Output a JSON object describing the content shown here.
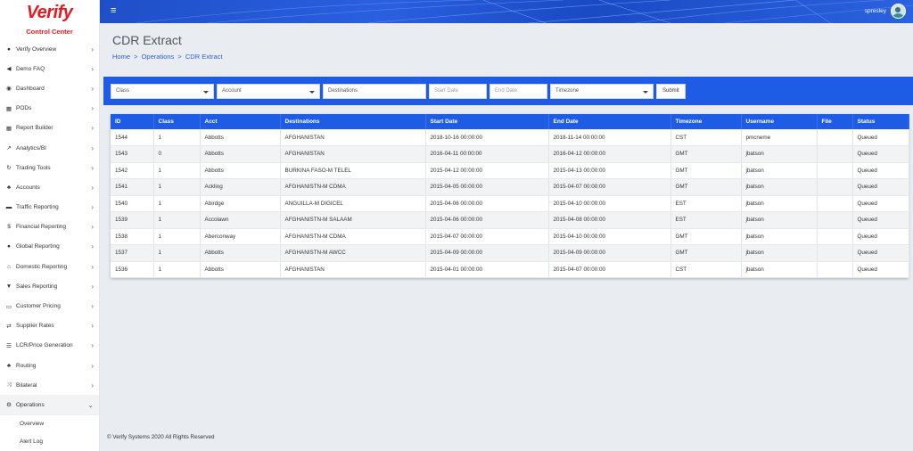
{
  "brand": {
    "logo": "Verify",
    "subtitle": "Control Center"
  },
  "colors": {
    "accent": "#1f5ce6",
    "brand_red": "#e21b23"
  },
  "sidebar": {
    "items": [
      {
        "label": "Verify Overview",
        "icon": "globe-icon",
        "glyph": "●"
      },
      {
        "label": "Demo FAQ",
        "icon": "megaphone-icon",
        "glyph": "◀"
      },
      {
        "label": "Dashboard",
        "icon": "dashboard-icon",
        "glyph": "◉"
      },
      {
        "label": "PODs",
        "icon": "table-icon",
        "glyph": "▦"
      },
      {
        "label": "Report Builder",
        "icon": "grid-icon",
        "glyph": "▦"
      },
      {
        "label": "Analytics/BI",
        "icon": "chart-icon",
        "glyph": "↗"
      },
      {
        "label": "Trading Tools",
        "icon": "refresh-icon",
        "glyph": "↻"
      },
      {
        "label": "Accounts",
        "icon": "users-icon",
        "glyph": "♣"
      },
      {
        "label": "Traffic Reporting",
        "icon": "car-icon",
        "glyph": "▬"
      },
      {
        "label": "Financial Reporting",
        "icon": "dollar-icon",
        "glyph": "$"
      },
      {
        "label": "Global Reporting",
        "icon": "globe-icon",
        "glyph": "●"
      },
      {
        "label": "Domestic Reporting",
        "icon": "home-icon",
        "glyph": "⌂"
      },
      {
        "label": "Sales Reporting",
        "icon": "cart-icon",
        "glyph": "▼"
      },
      {
        "label": "Customer Pricing",
        "icon": "money-icon",
        "glyph": "▭"
      },
      {
        "label": "Supplier Rates",
        "icon": "exchange-icon",
        "glyph": "⇄"
      },
      {
        "label": "LCR/Price Generation",
        "icon": "list-icon",
        "glyph": "☰"
      },
      {
        "label": "Routing",
        "icon": "sitemap-icon",
        "glyph": "♣"
      },
      {
        "label": "Bilateral",
        "icon": "shuffle-icon",
        "glyph": "⤨"
      },
      {
        "label": "Operations",
        "icon": "cogs-icon",
        "glyph": "⚙"
      }
    ],
    "chevron": "›",
    "open_chevron": "⌄",
    "sub_items": [
      {
        "label": "Overview"
      },
      {
        "label": "Alert Log"
      }
    ]
  },
  "topbar": {
    "menu_glyph": "≡",
    "username": "spresley"
  },
  "page": {
    "title": "CDR Extract",
    "breadcrumb": {
      "home": "Home",
      "section": "Operations",
      "current": "CDR Extract",
      "sep": ">"
    }
  },
  "filters": {
    "class_value": "Class",
    "account_value": "Account",
    "destinations_placeholder": "Destinations",
    "start_date_placeholder": "Start Date",
    "end_date_placeholder": "End Date",
    "timezone_value": "Timezone",
    "submit_label": "Submit"
  },
  "table": {
    "columns": [
      "ID",
      "Class",
      "Acct",
      "Destinations",
      "Start Date",
      "End Date",
      "Timezone",
      "Username",
      "File",
      "Status"
    ],
    "rows": [
      [
        "1544",
        "1",
        "Abbotts",
        "AFGHANISTAN",
        "2018-10-16 00:00:00",
        "2018-11-14 00:00:00",
        "CST",
        "pmcneme",
        "",
        "Queued"
      ],
      [
        "1543",
        "0",
        "Abbotts",
        "AFGHANISTAN",
        "2016-04-11 00:00:00",
        "2016-04-12 00:00:00",
        "GMT",
        "jbatson",
        "",
        "Queued"
      ],
      [
        "1542",
        "1",
        "Abbotts",
        "BURKINA FASO-M TELEL",
        "2015-04-12 00:00:00",
        "2015-04-13 00:00:00",
        "GMT",
        "jbatson",
        "",
        "Queued"
      ],
      [
        "1541",
        "1",
        "Ackling",
        "AFGHANISTN-M CDMA",
        "2015-04-05 00:00:00",
        "2015-04-07 00:00:00",
        "GMT",
        "jbatson",
        "",
        "Queued"
      ],
      [
        "1540",
        "1",
        "Abirdge",
        "ANGUILLA-M DIGICEL",
        "2015-04-06 00:00:00",
        "2015-04-10 00:00:00",
        "EST",
        "jbatson",
        "",
        "Queued"
      ],
      [
        "1539",
        "1",
        "Accolawn",
        "AFGHANISTN-M SALAAM",
        "2015-04-06 00:00:00",
        "2015-04-08 00:00:00",
        "EST",
        "jbatson",
        "",
        "Queued"
      ],
      [
        "1538",
        "1",
        "Aberconway",
        "AFGHANISTN-M CDMA",
        "2015-04-07 00:00:00",
        "2015-04-10 00:00:00",
        "GMT",
        "jbatson",
        "",
        "Queued"
      ],
      [
        "1537",
        "1",
        "Abbotts",
        "AFGHANISTN-M AWCC",
        "2015-04-09 00:00:00",
        "2015-04-09 00:00:00",
        "GMT",
        "jbatson",
        "",
        "Queued"
      ],
      [
        "1536",
        "1",
        "Abbotts",
        "AFGHANISTAN",
        "2015-04-01 00:00:00",
        "2015-04-07 00:00:00",
        "CST",
        "jbatson",
        "",
        "Queued"
      ]
    ]
  },
  "footer": {
    "text": "© Verify Systems 2020 All Rights Reserved"
  }
}
